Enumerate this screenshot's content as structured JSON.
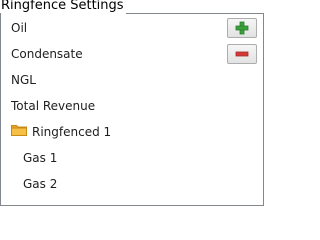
{
  "group": {
    "title": "Ringfence Settings"
  },
  "items": [
    {
      "label": "Oil"
    },
    {
      "label": "Condensate"
    },
    {
      "label": "NGL"
    },
    {
      "label": "Total Revenue"
    },
    {
      "label": "Ringfenced 1",
      "icon": "folder-icon"
    },
    {
      "label": "Gas 1"
    },
    {
      "label": "Gas 2"
    }
  ],
  "buttons": {
    "add": {
      "icon": "plus-icon",
      "color": "#3aa03a"
    },
    "remove": {
      "icon": "minus-icon",
      "color": "#d23a3a"
    }
  },
  "colors": {
    "folder": "#f2b536",
    "border": "#828790"
  }
}
